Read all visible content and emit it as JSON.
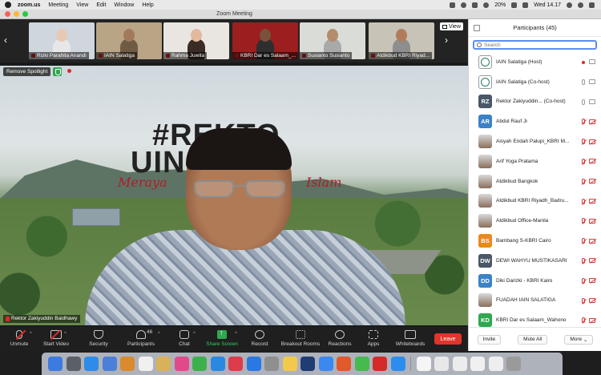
{
  "menubar": {
    "app_name": "zoom.us",
    "items": [
      "Meeting",
      "View",
      "Edit",
      "Window",
      "Help"
    ],
    "battery": "20%",
    "clock": "Wed 14.17"
  },
  "window": {
    "title": "Zoom Meeting"
  },
  "thumbnails": [
    {
      "name": "Rizki Parahita Anandi",
      "bg": "#cfd6de",
      "skin": "#e8c9b5",
      "cloth": "#e7e7e7",
      "muted": true
    },
    {
      "name": "IAIN Salatiga",
      "bg": "#b9a585",
      "skin": "#a27a5b",
      "cloth": "#6f5a44",
      "muted": true
    },
    {
      "name": "Rahma Juwita",
      "bg": "#e9e6e2",
      "skin": "#e2b99c",
      "cloth": "#3b2b25",
      "muted": true
    },
    {
      "name": "KBRI Dar es Salaam_...",
      "bg": "#9c1e1e",
      "skin": "#7a523b",
      "cloth": "#2e2e2e",
      "muted": true
    },
    {
      "name": "Susianto Susianto",
      "bg": "#d9dcd7",
      "skin": "#b48c6c",
      "cloth": "#a9a9a9",
      "muted": true
    },
    {
      "name": "Atdikbud KBRI Riyad...",
      "bg": "#c7c3b6",
      "skin": "#b27c5b",
      "cloth": "#8e8e8e",
      "muted": true
    }
  ],
  "view_label": "View",
  "spotlight_button": "Remove Spotlight",
  "recording_label": "Recording",
  "banner": {
    "line1": "#REKTO",
    "line2": "UIN   GA",
    "script_left": "Meraya",
    "script_right": "Islam"
  },
  "active_speaker": "Rektor Zakiyuddin Baidhawy",
  "toolbar": {
    "unmute": "Unmute",
    "start_video": "Start Video",
    "security": "Security",
    "participants": "Participants",
    "participant_count": "46",
    "chat": "Chat",
    "share_screen": "Share Screen",
    "record": "Record",
    "breakout": "Breakout Rooms",
    "reactions": "Reactions",
    "apps": "Apps",
    "whiteboards": "Whiteboards",
    "leave": "Leave"
  },
  "panel": {
    "title": "Participants (45)",
    "search_placeholder": "Search",
    "participants": [
      {
        "name": "IAIN Salatiga (Host)",
        "avatar": "logo",
        "initials": "",
        "color": "#ffffff",
        "mic": "dot",
        "cam": "cam"
      },
      {
        "name": "IAIN Salatiga (Co-host)",
        "avatar": "logo",
        "initials": "",
        "color": "#ffffff",
        "mic": "mic",
        "cam": "cam"
      },
      {
        "name": "Rektor Zakiyuddin...  (Co-host)",
        "avatar": "initials",
        "initials": "RZ",
        "color": "#4a5868",
        "mic": "mic",
        "cam": "cam"
      },
      {
        "name": "Abdul Rauf Jr",
        "avatar": "initials",
        "initials": "AR",
        "color": "#3b82c6",
        "mic": "mic-off",
        "cam": "cam-off"
      },
      {
        "name": "Aisyah Endah Palupi_KBRI M...",
        "avatar": "photo",
        "initials": "",
        "color": "#999999",
        "mic": "mic-off",
        "cam": "cam-off"
      },
      {
        "name": "Arif Yoga Pratama",
        "avatar": "photo",
        "initials": "",
        "color": "#999999",
        "mic": "mic-off",
        "cam": "cam-off"
      },
      {
        "name": "Atdikbud Bangkok",
        "avatar": "photo",
        "initials": "",
        "color": "#999999",
        "mic": "mic-off",
        "cam": "cam-off"
      },
      {
        "name": "Atdikbud KBRI Riyadh_Badru...",
        "avatar": "photo",
        "initials": "",
        "color": "#999999",
        "mic": "mic-off",
        "cam": "cam-off"
      },
      {
        "name": "Atdikbud Office-Manila",
        "avatar": "photo",
        "initials": "",
        "color": "#999999",
        "mic": "mic-off",
        "cam": "cam-off"
      },
      {
        "name": "Bambang S-KBRI Cairo",
        "avatar": "initials",
        "initials": "BS",
        "color": "#e98a1c",
        "mic": "mic-off",
        "cam": "cam-off"
      },
      {
        "name": "DEWI WAHYU MUSTIKASARI",
        "avatar": "initials",
        "initials": "DW",
        "color": "#4a5868",
        "mic": "mic-off",
        "cam": "cam-off"
      },
      {
        "name": "Diki Darizki - KBRI Kairo",
        "avatar": "initials",
        "initials": "DD",
        "color": "#3b82c6",
        "mic": "mic-off",
        "cam": "cam-off"
      },
      {
        "name": "FUADAH IAIN SALATIGA",
        "avatar": "photo",
        "initials": "",
        "color": "#999999",
        "mic": "mic-off",
        "cam": "cam-off"
      },
      {
        "name": "KBRI Dar es Salaam_Wahono",
        "avatar": "initials",
        "initials": "KD",
        "color": "#2fa84f",
        "mic": "mic-off",
        "cam": "cam-off"
      }
    ],
    "invite": "Invite",
    "mute_all": "Mute All",
    "more": "More"
  },
  "dock_colors": [
    "#3c7be0",
    "#5b5f66",
    "#2e8be8",
    "#4b7fd8",
    "#d98a2f",
    "#f0f0f0",
    "#d9b15a",
    "#e04a8a",
    "#3db04d",
    "#2a88e0",
    "#dc3c4c",
    "#2a78e4",
    "#8f8f8f",
    "#f2c94c",
    "#1f3c73",
    "#3a88f0",
    "#e05a2a",
    "#46b94f",
    "#d62a2a",
    "#2d8cf0",
    "#f5f5f5",
    "#e8e8e8",
    "#ececec",
    "#f0f0f0",
    "#eeeeee",
    "#9a9a9a"
  ]
}
